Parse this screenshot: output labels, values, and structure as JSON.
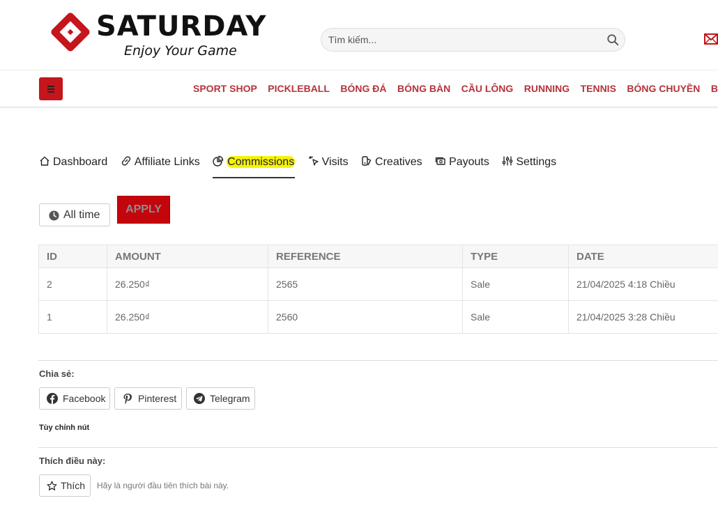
{
  "brand": {
    "name": "SATURDAY",
    "tagline": "Enjoy Your Game",
    "primary_color": "#c4161c"
  },
  "search": {
    "placeholder": "Tìm kiếm..."
  },
  "nav": {
    "items": [
      "SPORT SHOP",
      "PICKLEBALL",
      "BÓNG ĐÁ",
      "BÓNG BÀN",
      "CẦU LÔNG",
      "RUNNING",
      "TENNIS",
      "BÓNG CHUYỀN",
      "BÓN"
    ]
  },
  "tabs": [
    {
      "label": "Dashboard",
      "icon": "home-icon"
    },
    {
      "label": "Affiliate Links",
      "icon": "link-icon"
    },
    {
      "label": "Commissions",
      "icon": "pie-chart-icon",
      "active": true
    },
    {
      "label": "Visits",
      "icon": "cursor-click-icon"
    },
    {
      "label": "Creatives",
      "icon": "creative-icon"
    },
    {
      "label": "Payouts",
      "icon": "cash-icon"
    },
    {
      "label": "Settings",
      "icon": "sliders-icon"
    }
  ],
  "filters": {
    "range_label": "All time",
    "apply_label": "Apply"
  },
  "table": {
    "headers": [
      "ID",
      "AMOUNT",
      "REFERENCE",
      "TYPE",
      "DATE"
    ],
    "rows": [
      [
        "2",
        "26.250₫",
        "2565",
        "Sale",
        "21/04/2025 4:18 Chiều"
      ],
      [
        "1",
        "26.250₫",
        "2560",
        "Sale",
        "21/04/2025 3:28 Chiều"
      ]
    ]
  },
  "share": {
    "label": "Chia sẻ:",
    "facebook": "Facebook",
    "pinterest": "Pinterest",
    "telegram": "Telegram",
    "customize": "Tùy chỉnh nút"
  },
  "like": {
    "label": "Thích điều này:",
    "button": "Thích",
    "note": "Hãy là người đầu tiên thích bài này."
  }
}
